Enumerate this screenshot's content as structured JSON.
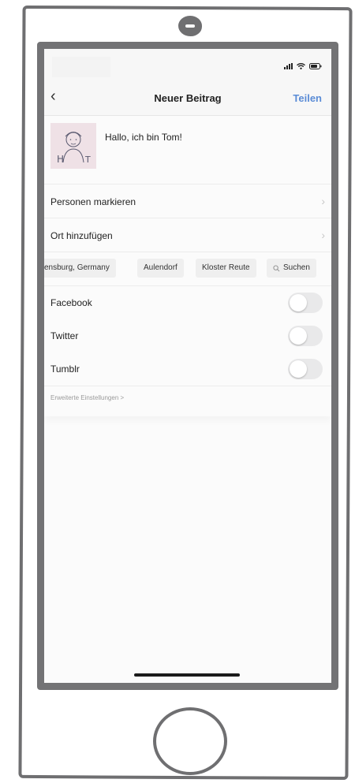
{
  "nav": {
    "back_icon": "chevron-left-icon",
    "title": "Neuer Beitrag",
    "share_label": "Teilen",
    "share_color": "#5b8cd6"
  },
  "post": {
    "caption": "Hallo, ich bin Tom!",
    "thumbnail_text": "H",
    "thumbnail_text_right": "T"
  },
  "options": {
    "tag_people": "Personen markieren",
    "add_location": "Ort hinzufügen"
  },
  "location_chips": [
    "ensburg, Germany",
    "Aulendorf",
    "Kloster Reute",
    "Suchen"
  ],
  "share_targets": [
    {
      "label": "Facebook",
      "enabled": false
    },
    {
      "label": "Twitter",
      "enabled": false
    },
    {
      "label": "Tumblr",
      "enabled": false
    }
  ],
  "advanced_settings": "Erweiterte Einstellungen >"
}
